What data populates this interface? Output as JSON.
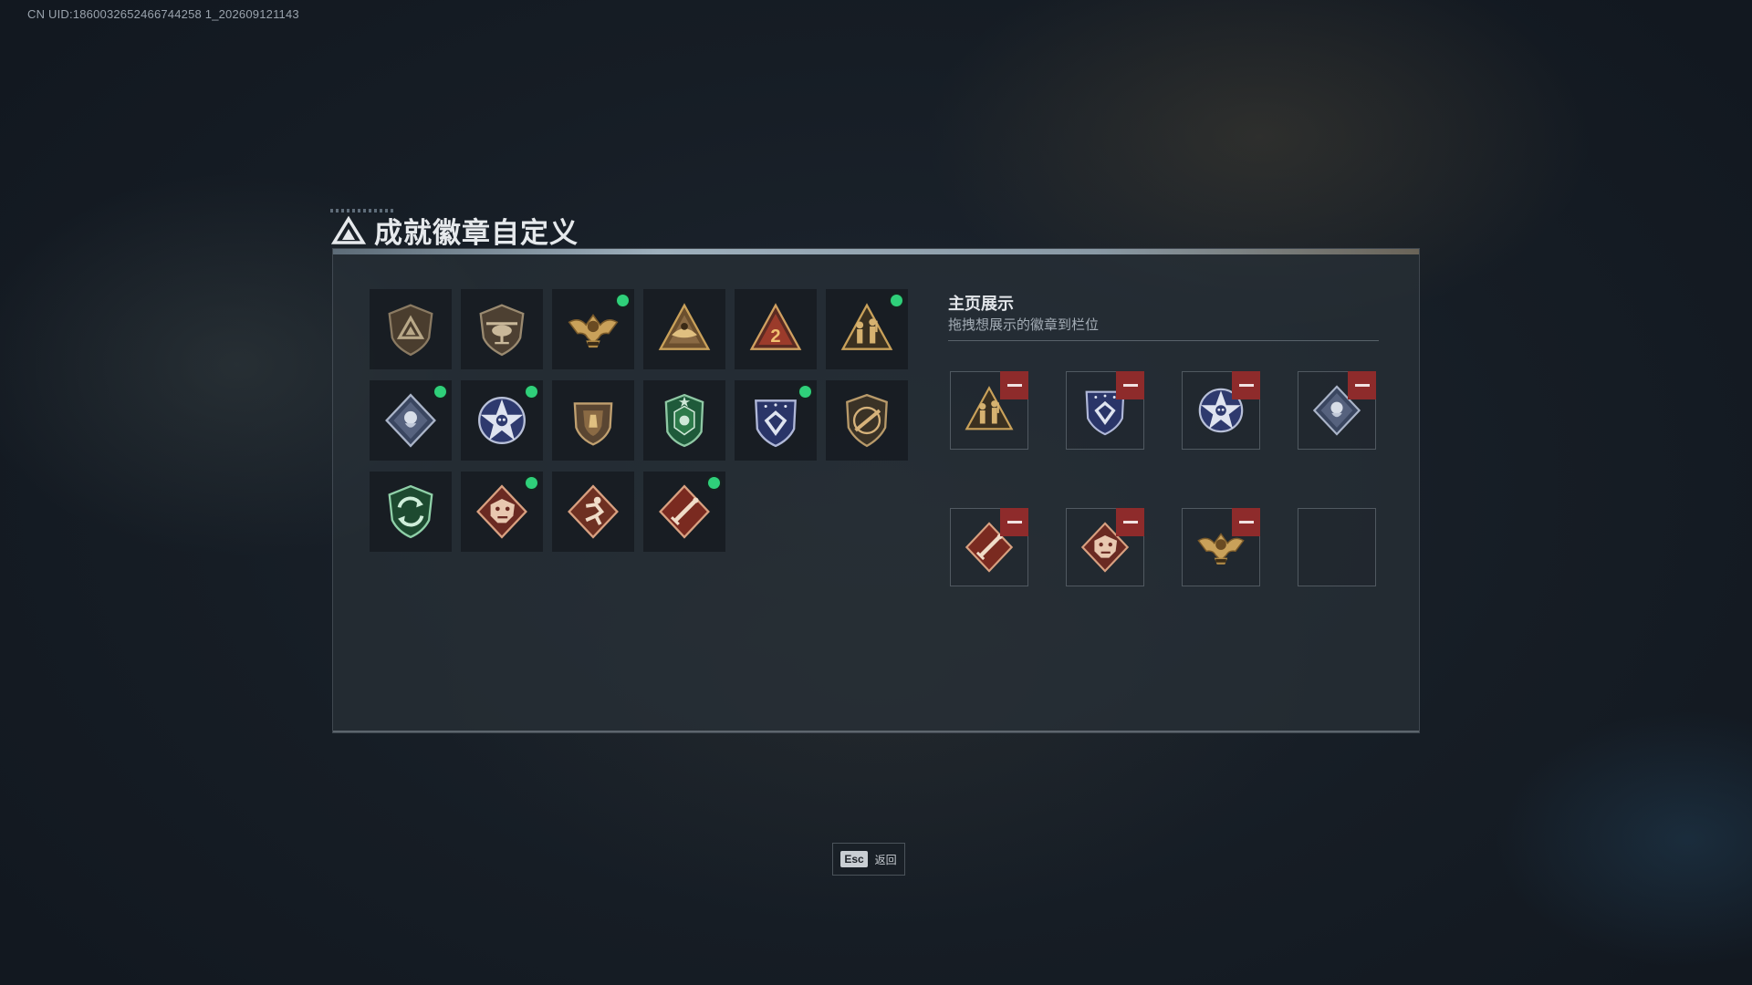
{
  "uid_text": "CN UID:1860032652466744258 1_202609121143",
  "title": "成就徽章自定义",
  "icons": {
    "title": "triangle-logo-icon",
    "new_indicator": "green-dot-icon",
    "remove": "minus-icon"
  },
  "colors": {
    "new_dot": "#2fd07a",
    "remove_bg": "#8e2b2b",
    "gold": "#c9a15a",
    "bronze": "#8a6a44",
    "navy": "#2e3a6e",
    "green": "#2d7a4a",
    "rust": "#8b3a2c"
  },
  "badges": [
    {
      "icon": "shield-triangle-badge-icon",
      "is_new": false
    },
    {
      "icon": "helicopter-shield-badge-icon",
      "is_new": false
    },
    {
      "icon": "golden-eagle-wings-badge-icon",
      "is_new": true
    },
    {
      "icon": "bronze-triangle-badge-icon",
      "is_new": false
    },
    {
      "icon": "triangle-number-2-badge-icon",
      "is_new": false
    },
    {
      "icon": "soldiers-triangle-badge-icon",
      "is_new": true
    },
    {
      "icon": "silver-diamond-rose-badge-icon",
      "is_new": true
    },
    {
      "icon": "star-skull-blue-badge-icon",
      "is_new": true
    },
    {
      "icon": "bronze-shield-emblem-badge-icon",
      "is_new": false
    },
    {
      "icon": "green-shield-star-badge-icon",
      "is_new": false
    },
    {
      "icon": "blue-shield-diamond-badge-icon",
      "is_new": true
    },
    {
      "icon": "rifle-shield-badge-icon",
      "is_new": false
    },
    {
      "icon": "green-arrows-shield-badge-icon",
      "is_new": false
    },
    {
      "icon": "dragon-diamond-badge-icon",
      "is_new": true
    },
    {
      "icon": "runner-diamond-badge-icon",
      "is_new": false
    },
    {
      "icon": "sword-diamond-badge-icon",
      "is_new": true
    }
  ],
  "showcase": {
    "title": "主页展示",
    "subtitle": "拖拽想展示的徽章到栏位",
    "slots": [
      {
        "icon": "soldiers-triangle-badge-icon",
        "filled": true
      },
      {
        "icon": "blue-shield-diamond-badge-icon",
        "filled": true
      },
      {
        "icon": "star-skull-blue-badge-icon",
        "filled": true
      },
      {
        "icon": "silver-diamond-rose-badge-icon",
        "filled": true
      },
      {
        "icon": "sword-diamond-badge-icon",
        "filled": true
      },
      {
        "icon": "dragon-diamond-badge-icon",
        "filled": true
      },
      {
        "icon": "golden-eagle-wings-badge-icon",
        "filled": true
      },
      {
        "icon": "",
        "filled": false
      }
    ]
  },
  "footer": {
    "esc_key": "Esc",
    "back_label": "返回"
  }
}
